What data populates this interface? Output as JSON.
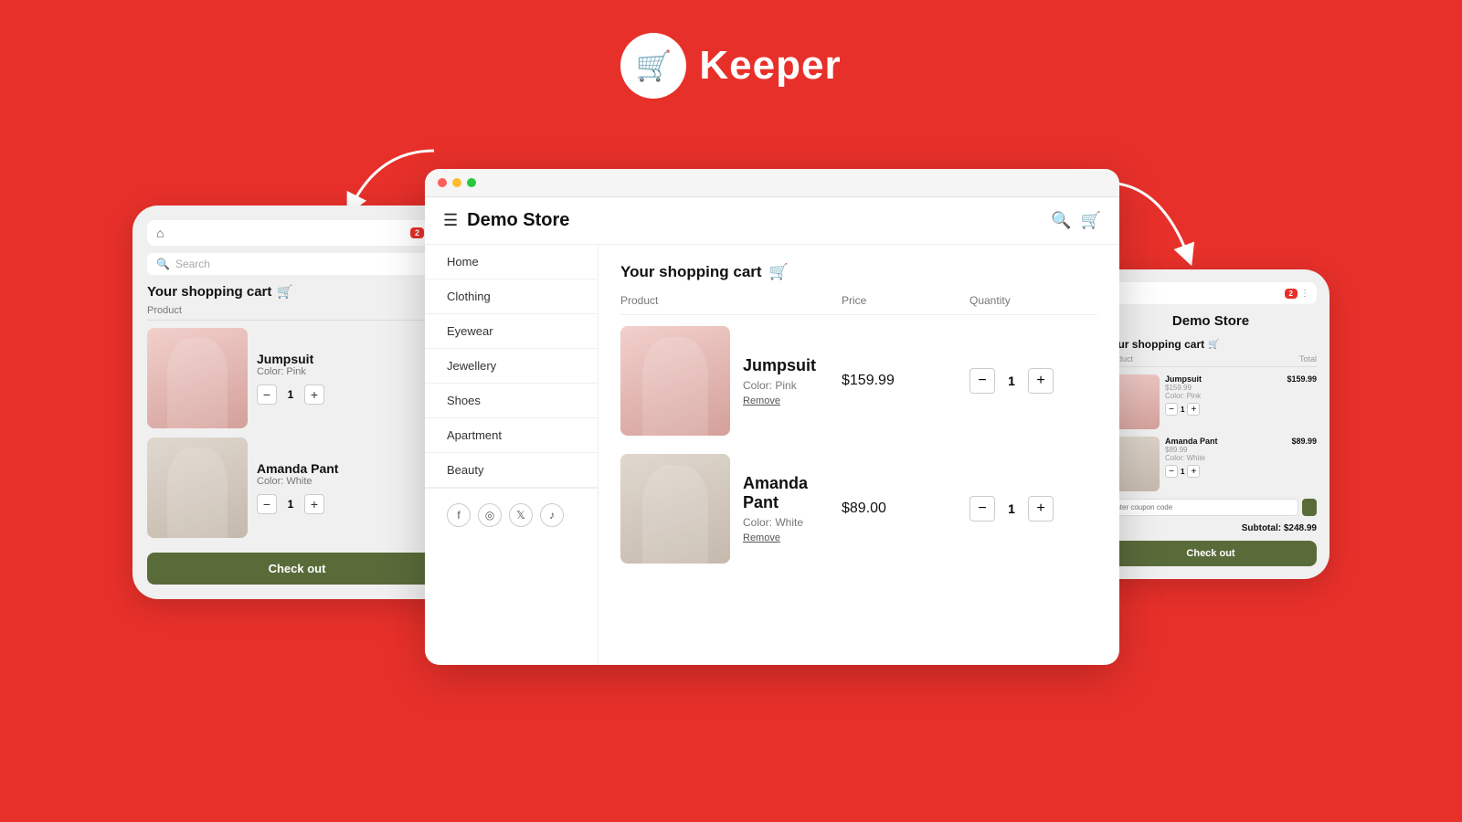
{
  "app": {
    "name": "Keeper",
    "logo_alt": "shopping cart logo"
  },
  "left_screen": {
    "badge": "2",
    "search_placeholder": "Search",
    "cart_title": "Your shopping cart",
    "product_label": "Product",
    "products": [
      {
        "name": "Jumpsuit",
        "color": "Color: Pink",
        "qty": "1"
      },
      {
        "name": "Amanda Pant",
        "color": "Color: White",
        "qty": "1"
      }
    ],
    "checkout_label": "Check out"
  },
  "center_screen": {
    "store_name": "Demo Store",
    "nav_items": [
      "Home",
      "Clothing",
      "Eyewear",
      "Jewellery",
      "Shoes",
      "Apartment",
      "Beauty"
    ],
    "cart_title": "Your shopping cart",
    "table_headers": {
      "product": "Product",
      "price": "Price",
      "quantity": "Quantity"
    },
    "products": [
      {
        "name": "Jumpsuit",
        "color": "Color: Pink",
        "remove": "Remove",
        "price": "$159.99",
        "qty": "1"
      },
      {
        "name": "Amanda Pant",
        "color": "Color: White",
        "remove": "Remove",
        "price": "$89.00",
        "qty": "1"
      }
    ]
  },
  "right_screen": {
    "store_name": "Demo Store",
    "badge": "2",
    "cart_title": "Your shopping cart",
    "table_header_product": "Product",
    "table_header_total": "Total",
    "products": [
      {
        "name": "Jumpsuit",
        "price": "$159.99",
        "price2": "$159.99",
        "color": "Color: Pink",
        "qty": "1"
      },
      {
        "name": "Amanda Pant",
        "price": "$89.99",
        "price2": "$89.99",
        "color": "Color: White",
        "qty": "1"
      }
    ],
    "coupon_placeholder": "Enter coupon code",
    "subtotal": "Subtotal: $248.99",
    "checkout_label": "Check out"
  }
}
